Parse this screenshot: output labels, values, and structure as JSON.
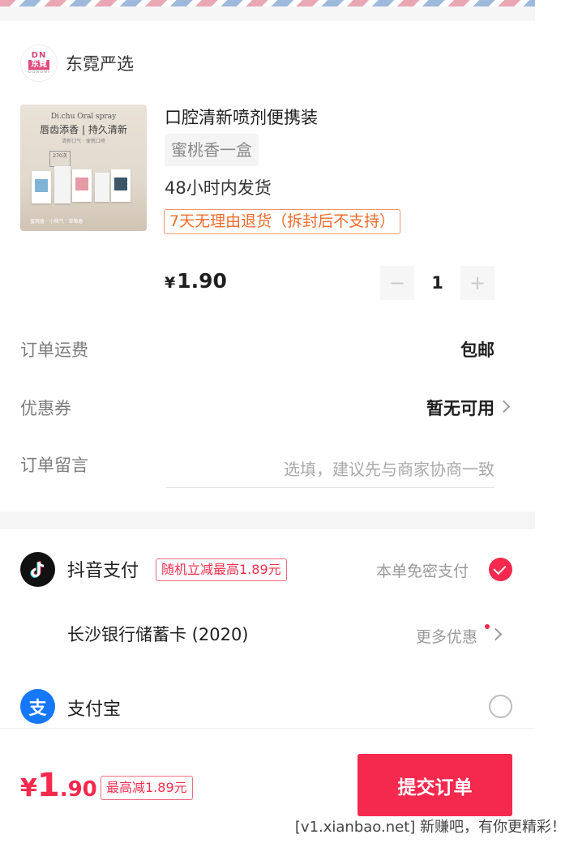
{
  "shop": {
    "logo_top": "DN",
    "logo_mid": "东霓",
    "logo_bottom": "DONGNI",
    "name": "东霓严选"
  },
  "product": {
    "image_text_1": "Di.chu Oral spray",
    "image_text_2": "唇齿添香 | 持久清新",
    "image_text_3": "清新口气 · 便携口喷",
    "image_badge": "270次",
    "image_text_4": "蜜桃香 · 小桃气 · 草莓香",
    "title": "口腔清新喷剂便携装",
    "sku": "蜜桃香一盒",
    "shipping": "48小时内发货",
    "return_policy": "7天无理由退货（拆封后不支持）",
    "price_symbol": "¥",
    "price": "1.90",
    "quantity": "1",
    "minus": "−",
    "plus": "+"
  },
  "order": {
    "freight_label": "订单运费",
    "freight_value": "包邮",
    "coupon_label": "优惠券",
    "coupon_value": "暂无可用",
    "note_label": "订单留言",
    "note_placeholder": "选填，建议先与商家协商一致"
  },
  "payment": {
    "douyin": {
      "name": "抖音支付",
      "promo": "随机立减最高1.89元",
      "hint": "本单免密支付",
      "selected": true,
      "icon": "douyin-icon"
    },
    "bank_card": {
      "name": "长沙银行储蓄卡 (2020)",
      "more": "更多优惠"
    },
    "alipay": {
      "name": "支付宝",
      "icon_glyph": "支",
      "selected": false
    }
  },
  "footer": {
    "currency": "¥",
    "total_int": "1",
    "total_dec": ".90",
    "max_discount": "最高减1.89元",
    "submit_label": "提交订单"
  },
  "watermark": "[v1.xianbao.net] 新赚吧，有你更精彩！",
  "colors": {
    "accent": "#f4294d",
    "return_tag": "#f06c2b"
  }
}
